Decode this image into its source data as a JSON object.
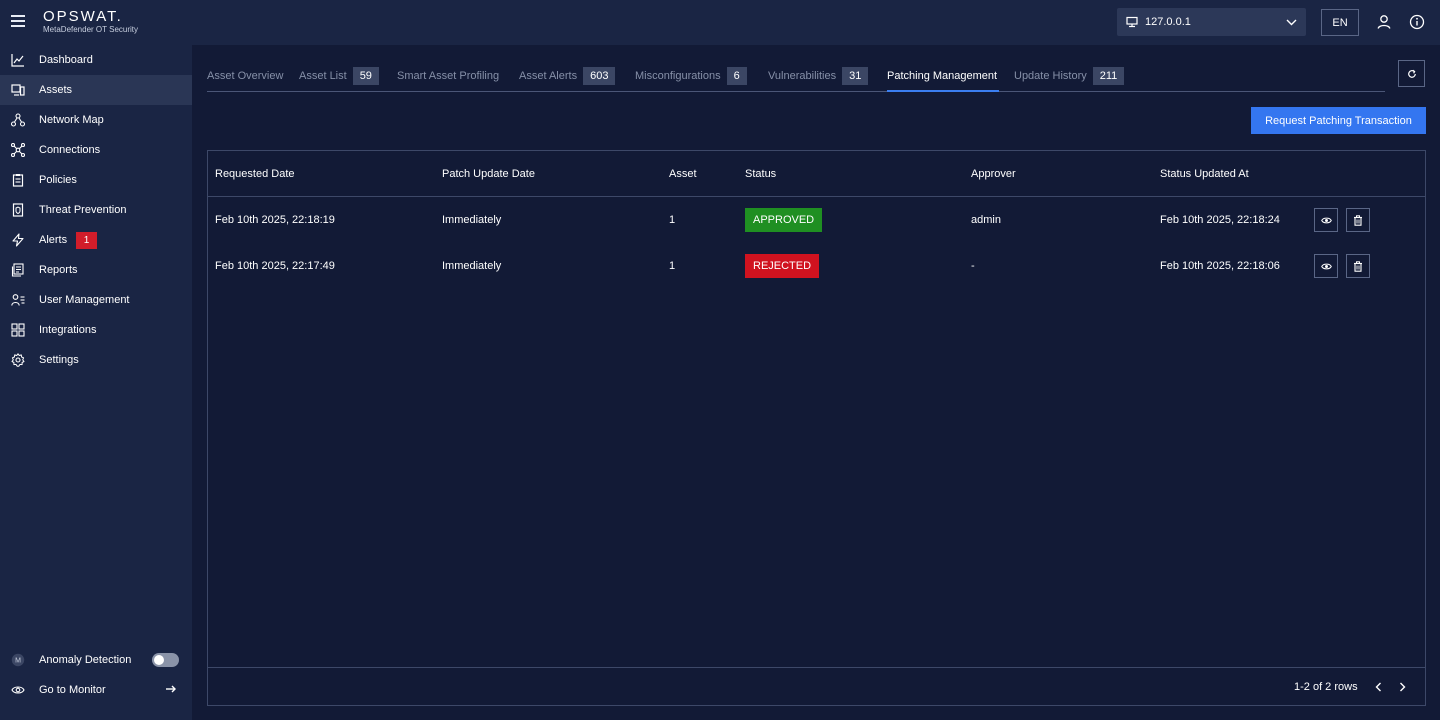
{
  "app": {
    "brand": "OPSWAT.",
    "product": "MetaDefender OT Security"
  },
  "header": {
    "ip": "127.0.0.1",
    "language": "EN"
  },
  "sidebar": {
    "items": [
      {
        "label": "Dashboard",
        "icon": "chart-line-icon"
      },
      {
        "label": "Assets",
        "icon": "devices-icon",
        "active": true
      },
      {
        "label": "Network Map",
        "icon": "network-icon"
      },
      {
        "label": "Connections",
        "icon": "connections-icon"
      },
      {
        "label": "Policies",
        "icon": "clipboard-icon"
      },
      {
        "label": "Threat Prevention",
        "icon": "document-shield-icon"
      },
      {
        "label": "Alerts",
        "icon": "bolt-icon",
        "badge": "1"
      },
      {
        "label": "Reports",
        "icon": "reports-icon"
      },
      {
        "label": "User Management",
        "icon": "users-icon"
      },
      {
        "label": "Integrations",
        "icon": "grid-icon"
      },
      {
        "label": "Settings",
        "icon": "gear-icon"
      }
    ],
    "bottom": [
      {
        "label": "Anomaly Detection",
        "icon": "anomaly-icon"
      },
      {
        "label": "Go to Monitor",
        "icon": "eye-icon"
      }
    ]
  },
  "tabs": [
    {
      "label": "Asset Overview",
      "count": ""
    },
    {
      "label": "Asset List",
      "count": "59"
    },
    {
      "label": "Smart Asset Profiling",
      "count": ""
    },
    {
      "label": "Asset Alerts",
      "count": "603"
    },
    {
      "label": "Misconfigurations",
      "count": "6"
    },
    {
      "label": "Vulnerabilities",
      "count": "31"
    },
    {
      "label": "Patching Management",
      "count": "",
      "active": true
    },
    {
      "label": "Update History",
      "count": "211"
    }
  ],
  "actions": {
    "request_label": "Request Patching Transaction"
  },
  "table": {
    "columns": [
      "Requested Date",
      "Patch Update Date",
      "Asset",
      "Status",
      "Approver",
      "Status Updated At"
    ],
    "rows": [
      {
        "requested": "Feb 10th 2025, 22:18:19",
        "patch_date": "Immediately",
        "asset": "1",
        "status": "APPROVED",
        "approver": "admin",
        "updated": "Feb 10th 2025, 22:18:24"
      },
      {
        "requested": "Feb 10th 2025, 22:17:49",
        "patch_date": "Immediately",
        "asset": "1",
        "status": "REJECTED",
        "approver": "-",
        "updated": "Feb 10th 2025, 22:18:06"
      }
    ],
    "pagination": "1-2 of 2 rows"
  },
  "colors": {
    "accent": "#3476f0",
    "approved": "#1f8f22",
    "rejected": "#d0121f",
    "alert_badge": "#d21d2a"
  }
}
